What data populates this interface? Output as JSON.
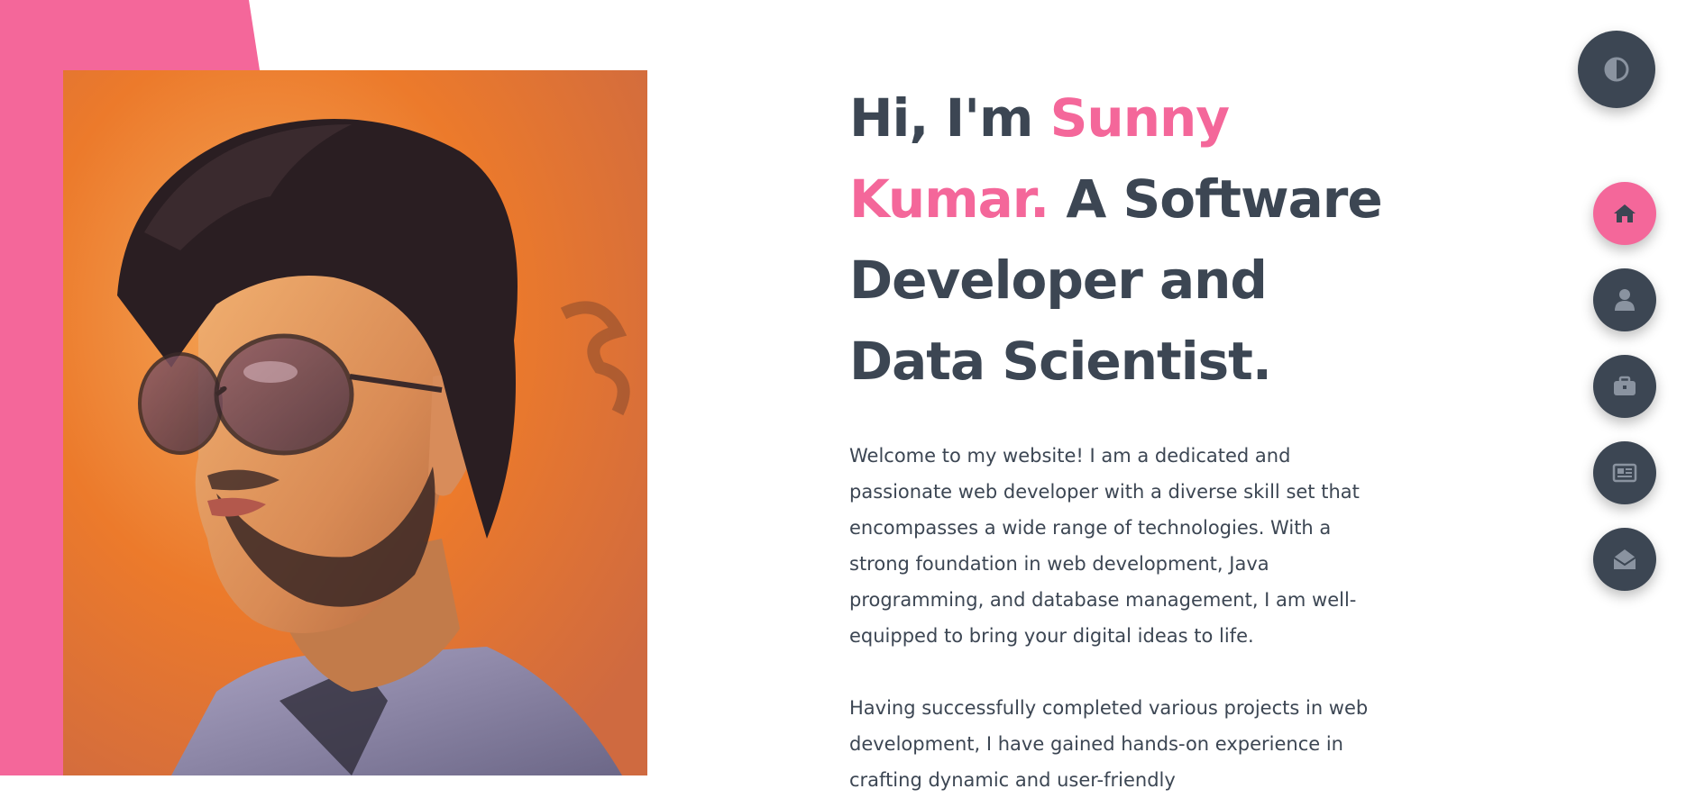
{
  "hero": {
    "greeting": "Hi, I'm ",
    "name_part1": "Sunny",
    "name_part2": "Kumar.",
    "role_part1": " A Software",
    "role_part2": "Developer and",
    "role_part3": "Data Scientist.",
    "intro": "Welcome to my website! I am a dedicated and passionate web developer with a diverse skill set that encompasses a wide range of technologies. With a strong foundation in web development, Java programming, and database management, I am well-equipped to bring your digital ideas to life.",
    "second": "Having successfully completed various projects in web development, I have gained hands-on experience in crafting dynamic and user-friendly"
  },
  "nav": {
    "items": [
      {
        "icon": "home-icon",
        "active": true
      },
      {
        "icon": "user-icon",
        "active": false
      },
      {
        "icon": "briefcase-icon",
        "active": false
      },
      {
        "icon": "newspaper-icon",
        "active": false
      },
      {
        "icon": "envelope-open-icon",
        "active": false
      }
    ]
  },
  "theme_toggle": {
    "icon": "contrast-icon"
  },
  "colors": {
    "accent": "#f4679a",
    "dark": "#3c4653",
    "icon_muted": "#8a93a0",
    "background": "#ffffff"
  }
}
